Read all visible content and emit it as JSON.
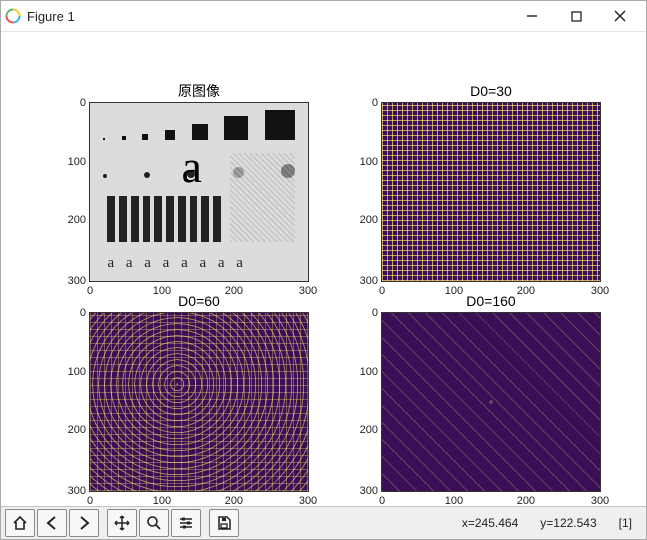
{
  "window": {
    "title": "Figure 1",
    "minimize": "—",
    "maximize": "▢",
    "close": "✕"
  },
  "chart_data": [
    {
      "type": "heatmap",
      "title": "原图像",
      "xlim": [
        0,
        300
      ],
      "ylim": [
        300,
        0
      ],
      "xticks": [
        0,
        100,
        200,
        300
      ],
      "yticks": [
        0,
        100,
        200,
        300
      ],
      "description": "grayscale test pattern image (squares of increasing size, circles, letter 'a', vertical bars, repeated 'a a a a a a a a')"
    },
    {
      "type": "heatmap",
      "title": "D0=30",
      "xlim": [
        0,
        300
      ],
      "ylim": [
        300,
        0
      ],
      "xticks": [
        0,
        100,
        200,
        300
      ],
      "yticks": [
        0,
        100,
        200,
        300
      ],
      "description": "high-pass/edge result, cutoff D0=30, strong yellow edges on purple"
    },
    {
      "type": "heatmap",
      "title": "D0=60",
      "xlim": [
        0,
        300
      ],
      "ylim": [
        300,
        0
      ],
      "xticks": [
        0,
        100,
        200,
        300
      ],
      "yticks": [
        0,
        100,
        200,
        300
      ],
      "description": "high-pass/edge result, cutoff D0=60, moderate yellow edges on purple"
    },
    {
      "type": "heatmap",
      "title": "D0=160",
      "xlim": [
        0,
        300
      ],
      "ylim": [
        300,
        0
      ],
      "xticks": [
        0,
        100,
        200,
        300
      ],
      "yticks": [
        0,
        100,
        200,
        300
      ],
      "description": "high-pass/edge result, cutoff D0=160, sparse yellow specks on purple"
    }
  ],
  "panel_titles": {
    "p1": "原图像",
    "p2": "D0=30",
    "p3": "D0=60",
    "p4": "D0=160"
  },
  "p1_text": {
    "big_a": "a",
    "aaa": "a a a a a a a a"
  },
  "ticks": {
    "x": [
      "0",
      "100",
      "200",
      "300"
    ],
    "y": [
      "0",
      "100",
      "200",
      "300"
    ]
  },
  "toolbar": {
    "home": "Home",
    "back": "Back",
    "forward": "Forward",
    "pan": "Pan",
    "zoom": "Zoom",
    "configure": "Configure subplots",
    "save": "Save"
  },
  "status": {
    "x_label": "x=",
    "x_val": "245.464",
    "y_label": "y=",
    "y_val": "122.543",
    "extra": "[1]"
  }
}
